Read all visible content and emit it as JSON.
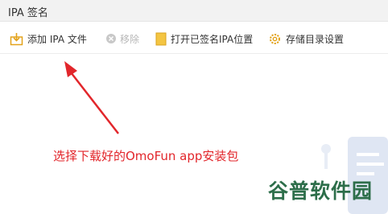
{
  "window": {
    "title": "IPA 签名"
  },
  "toolbar": {
    "add_label": "添加 IPA 文件",
    "remove_label": "移除",
    "open_folder_label": "打开已签名IPA位置",
    "storage_label": "存储目录设置"
  },
  "annotation": {
    "text": "选择下载好的OmoFun app安装包"
  },
  "watermark": {
    "text": "谷普软件园"
  },
  "colors": {
    "annotation": "#e2262b",
    "folder_icon": "#f4c542",
    "gear_icon": "#e3a21a",
    "watermark": "#2d6e4a"
  }
}
